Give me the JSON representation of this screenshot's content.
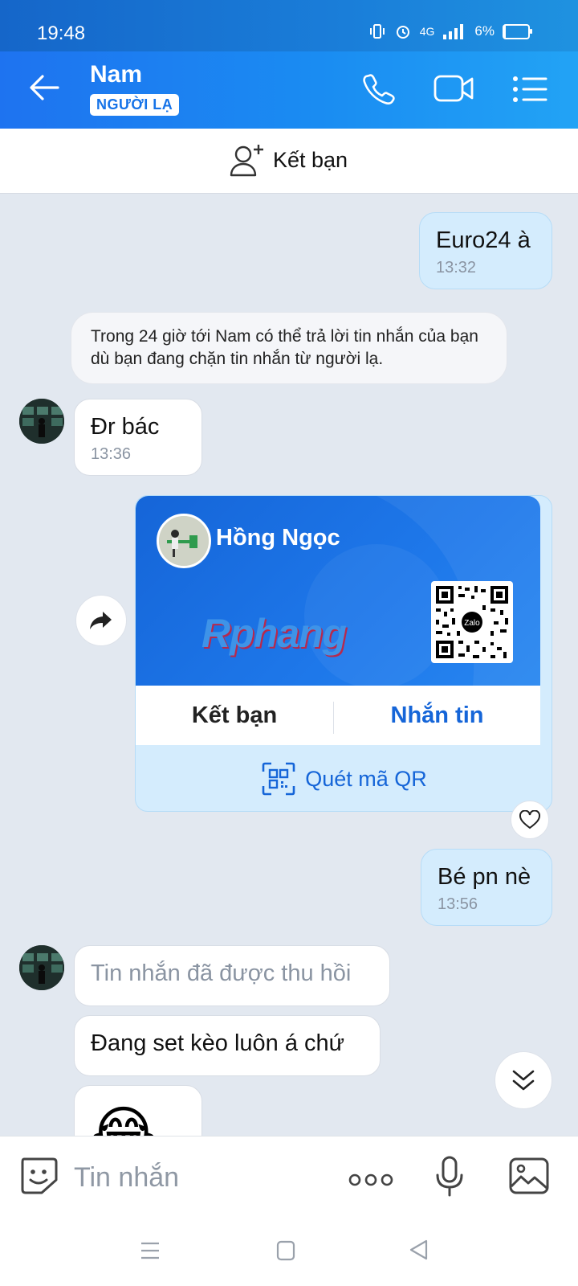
{
  "status_bar": {
    "time": "19:48",
    "network": "4G",
    "battery": "6%",
    "icons": [
      "vibrate-icon",
      "alarm-icon",
      "signal-icon",
      "battery-icon"
    ]
  },
  "header": {
    "contact_name": "Nam",
    "badge": "NGƯỜI LẠ",
    "icons": [
      "back-arrow-icon",
      "phone-icon",
      "video-call-icon",
      "menu-list-icon"
    ]
  },
  "friend_bar": {
    "label": "Kết bạn",
    "icon": "add-friend-icon"
  },
  "messages": {
    "m1": {
      "text": "Euro24 à",
      "time": "13:32",
      "from": "me"
    },
    "system_notice": "Trong 24 giờ tới Nam có thể trả lời tin nhắn của bạn dù bạn đang chặn tin nhắn từ người lạ.",
    "m2": {
      "text": "Đr bác",
      "time": "13:36",
      "from": "them"
    },
    "card": {
      "name": "Hồng Ngọc",
      "watermark": "Rphang",
      "qr_logo": "Zalo",
      "add_friend": "Kết bạn",
      "message": "Nhắn tin",
      "scan_qr": "Quét mã QR"
    },
    "m3": {
      "text": "Bé pn nè",
      "time": "13:56",
      "from": "me"
    },
    "m4": {
      "text": "Tin nhắn đã được thu hồi",
      "from": "them"
    },
    "m5": {
      "text": "Đang set kèo luôn á chứ",
      "from": "them"
    },
    "m6": {
      "emoji": "😂",
      "from": "them"
    }
  },
  "input_bar": {
    "placeholder": "Tin nhắn",
    "icons": [
      "sticker-icon",
      "more-icon",
      "microphone-icon",
      "image-icon"
    ]
  },
  "colors": {
    "header_start": "#1e73f0",
    "header_end": "#22a3f5",
    "my_bubble": "#d4ecfd",
    "chat_bg": "#e2e8f0",
    "link_blue": "#1565d8"
  }
}
